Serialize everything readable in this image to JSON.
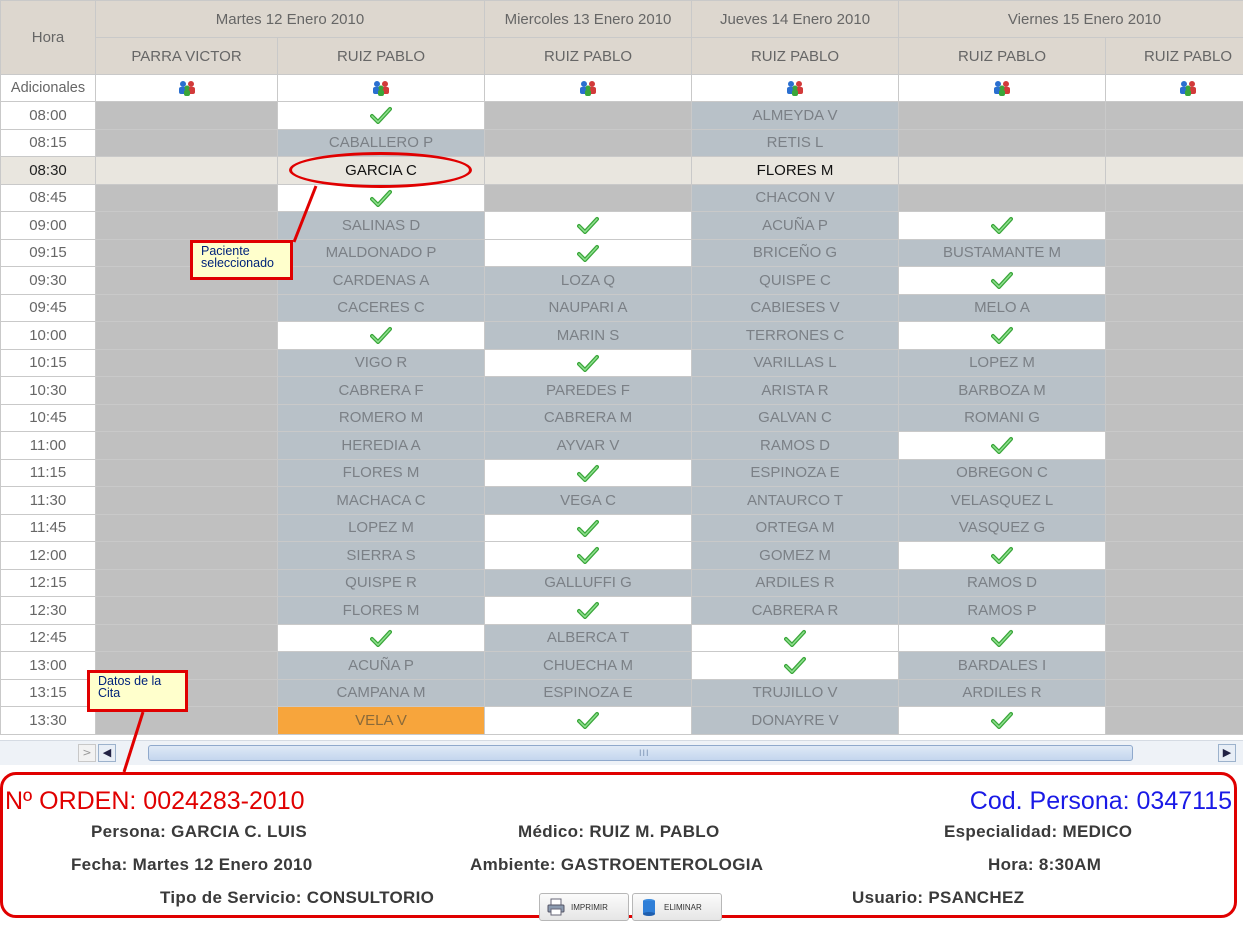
{
  "headers": {
    "hora": "Hora",
    "days": [
      {
        "label": "Martes 12 Enero 2010",
        "span": 2
      },
      {
        "label": "Miercoles 13 Enero 2010",
        "span": 1
      },
      {
        "label": "Jueves 14 Enero 2010",
        "span": 1
      },
      {
        "label": "Viernes 15 Enero 2010",
        "span": 2
      }
    ],
    "doctors": [
      "PARRA VICTOR",
      "RUIZ PABLO",
      "RUIZ PABLO",
      "RUIZ PABLO",
      "RUIZ PABLO",
      "RUIZ PABLO"
    ],
    "adicionales": "Adicionales"
  },
  "rows": [
    {
      "time": "08:00",
      "cells": [
        "B",
        "C",
        "B",
        "ALMEYDA V",
        "B",
        "B"
      ]
    },
    {
      "time": "08:15",
      "cells": [
        "B",
        "CABALLERO P",
        "B",
        "RETIS L",
        "B",
        "B"
      ]
    },
    {
      "time": "08:30",
      "cells": [
        "S",
        "GARCIA C",
        "S",
        "FLORES M",
        "S",
        "S"
      ]
    },
    {
      "time": "08:45",
      "cells": [
        "B",
        "C",
        "B",
        "CHACON V",
        "B",
        "B"
      ]
    },
    {
      "time": "09:00",
      "cells": [
        "B",
        "SALINAS D",
        "C",
        "ACUÑA P",
        "C",
        "B"
      ]
    },
    {
      "time": "09:15",
      "cells": [
        "B",
        "MALDONADO P",
        "C",
        "BRICEÑO G",
        "BUSTAMANTE M",
        "B"
      ]
    },
    {
      "time": "09:30",
      "cells": [
        "B",
        "CARDENAS A",
        "LOZA Q",
        "QUISPE C",
        "C",
        "B"
      ]
    },
    {
      "time": "09:45",
      "cells": [
        "B",
        "CACERES C",
        "NAUPARI A",
        "CABIESES V",
        "MELO A",
        "B"
      ]
    },
    {
      "time": "10:00",
      "cells": [
        "B",
        "C",
        "MARIN S",
        "TERRONES C",
        "C",
        "B"
      ]
    },
    {
      "time": "10:15",
      "cells": [
        "B",
        "VIGO R",
        "C",
        "VARILLAS L",
        "LOPEZ M",
        "B"
      ]
    },
    {
      "time": "10:30",
      "cells": [
        "B",
        "CABRERA F",
        "PAREDES F",
        "ARISTA R",
        "BARBOZA M",
        "B"
      ]
    },
    {
      "time": "10:45",
      "cells": [
        "B",
        "ROMERO M",
        "CABRERA M",
        "GALVAN C",
        "ROMANI G",
        "B"
      ]
    },
    {
      "time": "11:00",
      "cells": [
        "B",
        "HEREDIA A",
        "AYVAR V",
        "RAMOS D",
        "C",
        "B"
      ]
    },
    {
      "time": "11:15",
      "cells": [
        "B",
        "FLORES M",
        "C",
        "ESPINOZA E",
        "OBREGON C",
        "B"
      ]
    },
    {
      "time": "11:30",
      "cells": [
        "B",
        "MACHACA C",
        "VEGA C",
        "ANTAURCO T",
        "VELASQUEZ L",
        "B"
      ]
    },
    {
      "time": "11:45",
      "cells": [
        "B",
        "LOPEZ M",
        "C",
        "ORTEGA M",
        "VASQUEZ G",
        "B"
      ]
    },
    {
      "time": "12:00",
      "cells": [
        "B",
        "SIERRA S",
        "C",
        "GOMEZ M",
        "C",
        "B"
      ]
    },
    {
      "time": "12:15",
      "cells": [
        "B",
        "QUISPE R",
        "GALLUFFI G",
        "ARDILES R",
        "RAMOS D",
        "B"
      ]
    },
    {
      "time": "12:30",
      "cells": [
        "B",
        "FLORES M",
        "C",
        "CABRERA R",
        "RAMOS P",
        "B"
      ]
    },
    {
      "time": "12:45",
      "cells": [
        "B",
        "C",
        "ALBERCA T",
        "C",
        "C",
        "B"
      ]
    },
    {
      "time": "13:00",
      "cells": [
        "B",
        "ACUÑA P",
        "CHUECHA M",
        "C",
        "BARDALES I",
        "B"
      ]
    },
    {
      "time": "13:15",
      "cells": [
        "B",
        "CAMPANA M",
        "ESPINOZA E",
        "TRUJILLO V",
        "ARDILES R",
        "B"
      ]
    },
    {
      "time": "13:30",
      "cells": [
        "B",
        "O:VELA V",
        "C",
        "DONAYRE V",
        "C",
        "B"
      ]
    }
  ],
  "callouts": {
    "paciente": "Paciente seleccionado",
    "datos": "Datos de la Cita"
  },
  "cita": {
    "orden": "Nº ORDEN: 0024283-2010",
    "cod_persona": "Cod. Persona: 0347115",
    "persona": "Persona: GARCIA C. LUIS",
    "medico": "Médico: RUIZ M. PABLO",
    "especialidad": "Especialidad: MEDICO",
    "fecha": "Fecha: Martes 12 Enero 2010",
    "ambiente": "Ambiente: GASTROENTEROLOGIA",
    "hora": "Hora: 8:30AM",
    "tipo_servicio": "Tipo de Servicio: CONSULTORIO",
    "usuario": "Usuario: PSANCHEZ",
    "btn_imprimir": "IMPRIMIR",
    "btn_eliminar": "ELIMINAR"
  },
  "scrollbar": {
    "grip": "III"
  },
  "colors": {
    "annotation_red": "#e00000",
    "orden_red": "#e00000",
    "cod_blue": "#1a1ae6",
    "slot_taken": "#b8c1c8",
    "slot_blocked": "#c0c0c0",
    "slot_highlight": "#f7a53c"
  },
  "icons": {
    "adicionales": "people-icon",
    "available": "checkmark-icon",
    "imprimir": "printer-icon",
    "eliminar": "trash-icon",
    "scroll_left": "arrow-left-icon",
    "scroll_right": "arrow-right-icon"
  }
}
